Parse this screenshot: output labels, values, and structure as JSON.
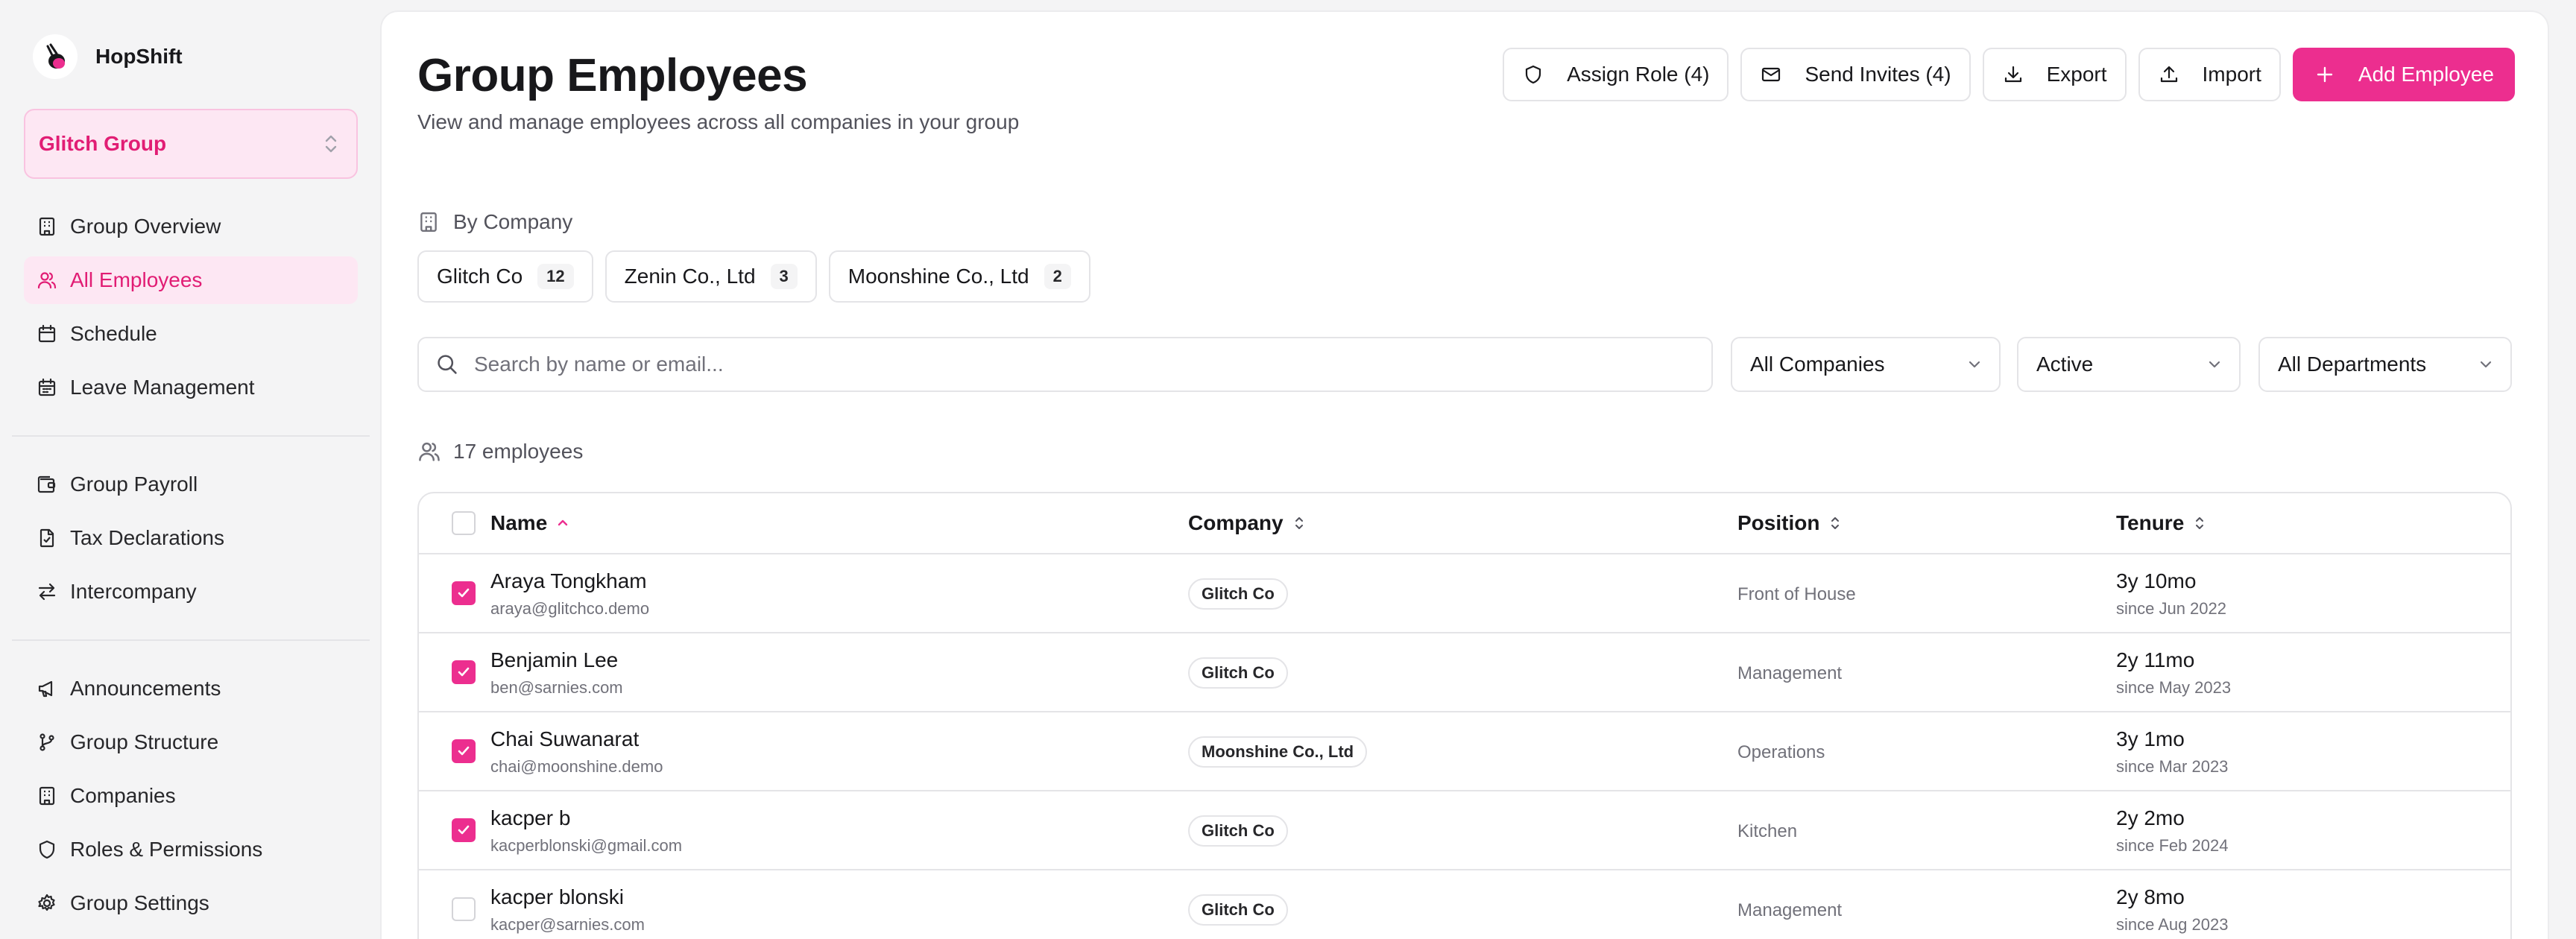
{
  "app": {
    "name": "HopShift"
  },
  "group_switcher": {
    "label": "Glitch Group"
  },
  "sidebar": {
    "sections": [
      {
        "items": [
          {
            "label": "Group Overview",
            "icon": "building-icon",
            "active": false
          },
          {
            "label": "All Employees",
            "icon": "users-icon",
            "active": true
          },
          {
            "label": "Schedule",
            "icon": "calendar-icon",
            "active": false
          },
          {
            "label": "Leave Management",
            "icon": "calendar-grid-icon",
            "active": false
          }
        ]
      },
      {
        "items": [
          {
            "label": "Group Payroll",
            "icon": "wallet-icon",
            "active": false
          },
          {
            "label": "Tax Declarations",
            "icon": "file-icon",
            "active": false
          },
          {
            "label": "Intercompany",
            "icon": "arrows-left-right-icon",
            "active": false
          }
        ]
      },
      {
        "items": [
          {
            "label": "Announcements",
            "icon": "megaphone-icon",
            "active": false
          },
          {
            "label": "Group Structure",
            "icon": "git-branch-icon",
            "active": false
          },
          {
            "label": "Companies",
            "icon": "building-icon",
            "active": false
          },
          {
            "label": "Roles & Permissions",
            "icon": "shield-icon",
            "active": false
          },
          {
            "label": "Group Settings",
            "icon": "gear-icon",
            "active": false
          }
        ]
      }
    ]
  },
  "header": {
    "title": "Group Employees",
    "subtitle": "View and manage employees across all companies in your group"
  },
  "actions": {
    "assign_role": "Assign Role (4)",
    "send_invites": "Send Invites (4)",
    "export": "Export",
    "import": "Import",
    "add_employee": "Add Employee"
  },
  "by_company": {
    "label": "By Company",
    "companies": [
      {
        "name": "Glitch Co",
        "count": "12"
      },
      {
        "name": "Zenin Co., Ltd",
        "count": "3"
      },
      {
        "name": "Moonshine Co., Ltd",
        "count": "2"
      }
    ]
  },
  "filters": {
    "search_placeholder": "Search by name or email...",
    "company": "All Companies",
    "status": "Active",
    "department": "All Departments"
  },
  "employee_count": "17 employees",
  "table": {
    "columns": {
      "name": "Name",
      "company": "Company",
      "position": "Position",
      "tenure": "Tenure"
    },
    "rows": [
      {
        "name": "Araya Tongkham",
        "email": "araya@glitchco.demo",
        "company": "Glitch Co",
        "position": "Front of House",
        "tenure": "3y 10mo",
        "since": "since Jun 2022",
        "selected": true
      },
      {
        "name": "Benjamin Lee",
        "email": "ben@sarnies.com",
        "company": "Glitch Co",
        "position": "Management",
        "tenure": "2y 11mo",
        "since": "since May 2023",
        "selected": true
      },
      {
        "name": "Chai Suwanarat",
        "email": "chai@moonshine.demo",
        "company": "Moonshine Co., Ltd",
        "position": "Operations",
        "tenure": "3y 1mo",
        "since": "since Mar 2023",
        "selected": true
      },
      {
        "name": "kacper b",
        "email": "kacperblonski@gmail.com",
        "company": "Glitch Co",
        "position": "Kitchen",
        "tenure": "2y 2mo",
        "since": "since Feb 2024",
        "selected": true
      },
      {
        "name": "kacper blonski",
        "email": "kacper@sarnies.com",
        "company": "Glitch Co",
        "position": "Management",
        "tenure": "2y 8mo",
        "since": "since Aug 2023",
        "selected": false
      }
    ]
  },
  "colors": {
    "accent": "#ec2e8f",
    "accent_soft": "#fde7f3",
    "accent_text": "#e11d74"
  }
}
